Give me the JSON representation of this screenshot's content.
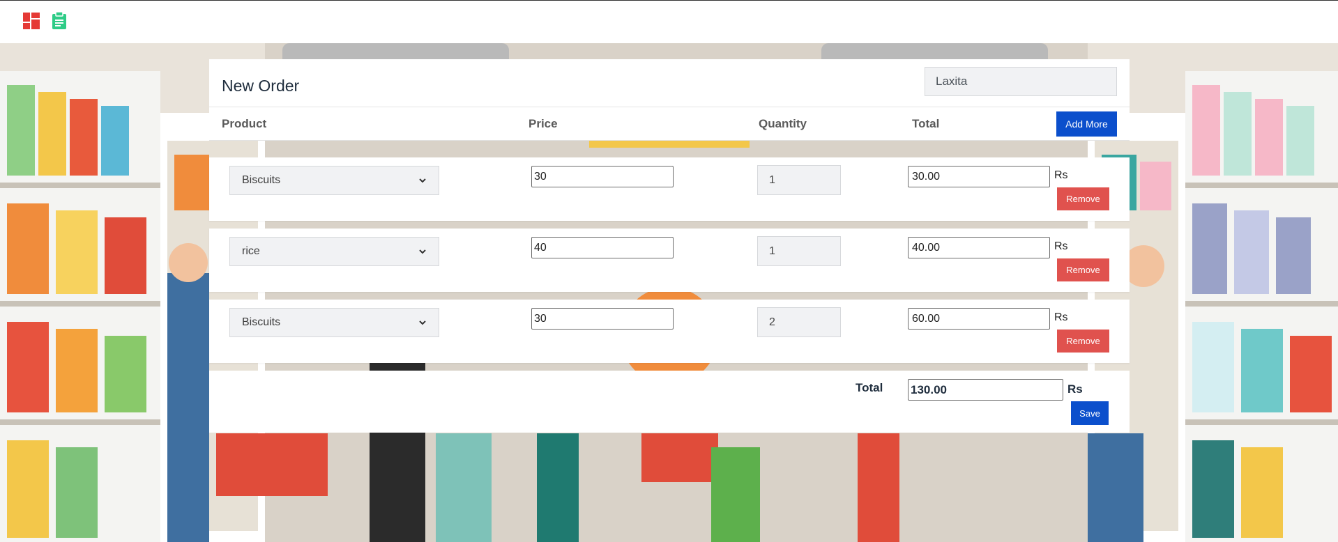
{
  "nav": {
    "dashboard_icon": "dashboard-grid-icon",
    "orders_icon": "clipboard-icon",
    "colors": {
      "dashboard": "#e53935",
      "orders": "#2ecc87"
    }
  },
  "header": {
    "title": "New Order",
    "customer_name": "Laxita",
    "add_more_label": "Add More"
  },
  "columns": {
    "product": "Product",
    "price": "Price",
    "quantity": "Quantity",
    "total": "Total"
  },
  "rows": [
    {
      "product": "Biscuits",
      "price": "30",
      "quantity": "1",
      "total": "30.00",
      "currency": "Rs",
      "remove_label": "Remove"
    },
    {
      "product": "rice",
      "price": "40",
      "quantity": "1",
      "total": "40.00",
      "currency": "Rs",
      "remove_label": "Remove"
    },
    {
      "product": "Biscuits",
      "price": "30",
      "quantity": "2",
      "total": "60.00",
      "currency": "Rs",
      "remove_label": "Remove"
    }
  ],
  "footer": {
    "total_label": "Total",
    "grand_total": "130.00",
    "currency": "Rs",
    "save_label": "Save"
  },
  "colors": {
    "primary": "#0b4fcc",
    "danger": "#e0524e"
  }
}
